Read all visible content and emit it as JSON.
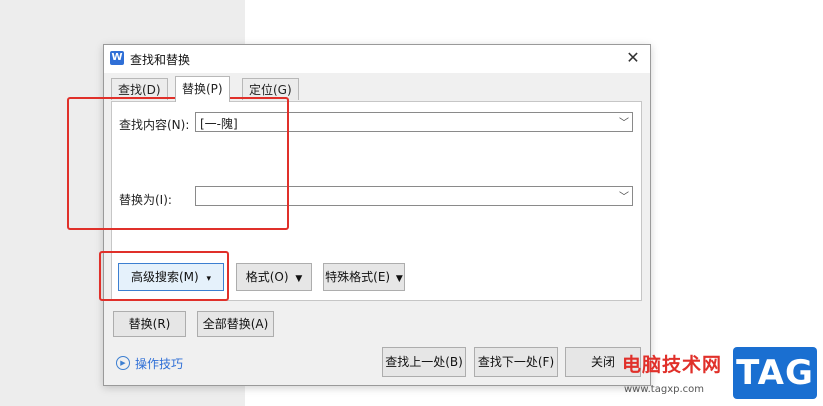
{
  "window": {
    "title": "查找和替换",
    "app_icon": "W"
  },
  "tabs": [
    {
      "label": "查找(D)"
    },
    {
      "label": "替换(P)"
    },
    {
      "label": "定位(G)"
    }
  ],
  "replace_panel": {
    "find_label": "查找内容(N):",
    "find_value": "[一-隗]",
    "replace_label": "替换为(I):",
    "replace_value": ""
  },
  "option_buttons": {
    "advanced": "高级搜索(M)",
    "format": "格式(O)",
    "special": "特殊格式(E)"
  },
  "action_buttons": {
    "replace": "替换(R)",
    "replace_all": "全部替换(A)",
    "find_prev": "查找上一处(B)",
    "find_next": "查找下一处(F)",
    "close": "关闭"
  },
  "hint": {
    "label": "操作技巧"
  },
  "watermark": {
    "text": "电脑技术网",
    "url": "www.tagxp.com",
    "tag": "TAG"
  },
  "colors": {
    "accent": "#2f6fd6",
    "annotation": "#e0302a"
  }
}
